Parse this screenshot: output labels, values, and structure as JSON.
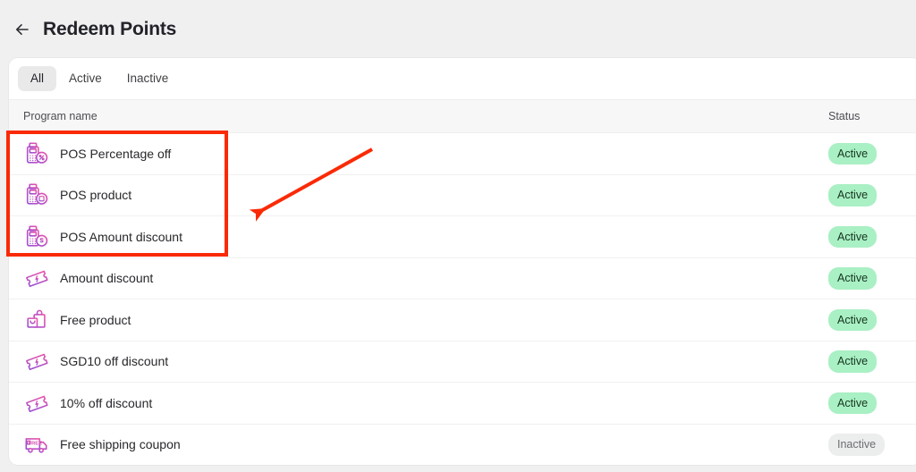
{
  "header": {
    "back_icon": "arrow-left-icon",
    "title": "Redeem Points"
  },
  "tabs": [
    {
      "label": "All",
      "selected": true
    },
    {
      "label": "Active",
      "selected": false
    },
    {
      "label": "Inactive",
      "selected": false
    }
  ],
  "table": {
    "columns": [
      {
        "key": "program_name",
        "label": "Program name"
      },
      {
        "key": "status",
        "label": "Status"
      }
    ],
    "rows": [
      {
        "icon": "pos-percentage-icon",
        "program_name": "POS Percentage off",
        "status": "Active"
      },
      {
        "icon": "pos-product-icon",
        "program_name": "POS product",
        "status": "Active"
      },
      {
        "icon": "pos-amount-icon",
        "program_name": "POS Amount discount",
        "status": "Active"
      },
      {
        "icon": "coupon-icon",
        "program_name": "Amount discount",
        "status": "Active"
      },
      {
        "icon": "shopping-bag-icon",
        "program_name": "Free product",
        "status": "Active"
      },
      {
        "icon": "coupon-icon",
        "program_name": "SGD10 off discount",
        "status": "Active"
      },
      {
        "icon": "coupon-icon",
        "program_name": "10% off discount",
        "status": "Active"
      },
      {
        "icon": "free-shipping-truck-icon",
        "program_name": "Free shipping coupon",
        "status": "Inactive"
      }
    ]
  },
  "annotations": {
    "highlight_box_color": "#fa2a06",
    "arrow_color": "#fa2a06"
  },
  "colors": {
    "page_background": "#f0f0f0",
    "card_background": "#ffffff",
    "active_badge_bg": "#a9f0c4",
    "inactive_badge_bg": "#eceded",
    "icon_gradient_start": "#a855d6",
    "icon_gradient_end": "#e056a8"
  }
}
